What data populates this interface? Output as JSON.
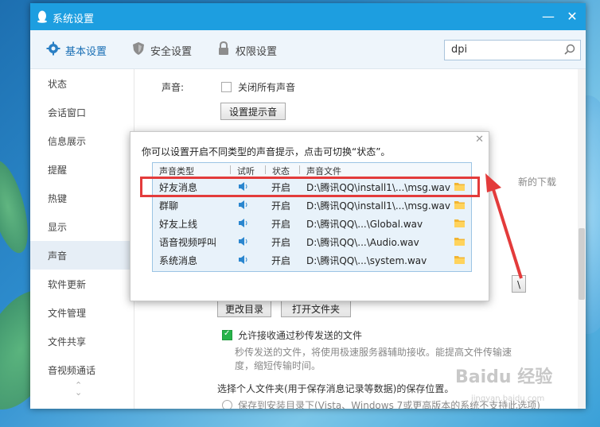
{
  "window": {
    "title": "系统设置",
    "minimize_icon": "minimize-icon",
    "close_icon": "close-icon"
  },
  "tabs": [
    {
      "label": "基本设置",
      "icon": "gear-icon",
      "active": true
    },
    {
      "label": "安全设置",
      "icon": "shield-icon",
      "active": false
    },
    {
      "label": "权限设置",
      "icon": "lock-icon",
      "active": false
    }
  ],
  "search": {
    "value": "dpi",
    "icon": "search-icon"
  },
  "sidebar": {
    "items": [
      "状态",
      "会话窗口",
      "信息展示",
      "提醒",
      "热键",
      "显示",
      "声音",
      "软件更新",
      "文件管理",
      "文件共享",
      "音视频通话"
    ],
    "active_index": 6
  },
  "content": {
    "sound_label": "声音:",
    "mute_all": "关闭所有声音",
    "set_sound_button": "设置提示音",
    "partial_right_text": "新的下载",
    "partial_box_char": "\\",
    "change_dir_button": "更改目录",
    "open_folder_button": "打开文件夹",
    "allow_flash_transfer": "允许接收通过秒传发送的文件",
    "flash_desc_1": "秒传发送的文件，将使用极速服务器辅助接收。能提高文件传输速",
    "flash_desc_2": "度，缩短传输时间。",
    "save_location_label": "选择个人文件夹(用于保存消息记录等数据)的保存位置。",
    "save_option_1": "保存到安装目录下(Vista、Windows 7或更高版本的系统不支持此选项)"
  },
  "dialog": {
    "message": "你可以设置开启不同类型的声音提示，点击可切换“状态”。",
    "columns": [
      "声音类型",
      "试听",
      "状态",
      "声音文件"
    ],
    "rows": [
      {
        "type": "好友消息",
        "status": "开启",
        "file": "D:\\腾讯QQ\\install1\\...\\msg.wav"
      },
      {
        "type": "群聊",
        "status": "开启",
        "file": "D:\\腾讯QQ\\install1\\...\\msg.wav"
      },
      {
        "type": "好友上线",
        "status": "开启",
        "file": "D:\\腾讯QQ\\...\\Global.wav"
      },
      {
        "type": "语音视频呼叫",
        "status": "开启",
        "file": "D:\\腾讯QQ\\...\\Audio.wav"
      },
      {
        "type": "系统消息",
        "status": "开启",
        "file": "D:\\腾讯QQ\\...\\system.wav"
      }
    ]
  },
  "watermark": {
    "text": "Baidu 经验",
    "sub": "jingyan.baidu.com"
  },
  "colors": {
    "titlebar": "#1d9ee0",
    "highlight": "#e33b3b",
    "accent": "#1a6fb5",
    "checkbox_on": "#27b34a"
  }
}
